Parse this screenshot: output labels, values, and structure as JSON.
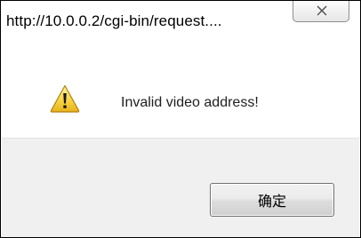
{
  "window": {
    "title": "http://10.0.0.2/cgi-bin/request....",
    "close_icon": "close-icon"
  },
  "message": {
    "icon": "warning-icon",
    "text": "Invalid video address!"
  },
  "buttons": {
    "ok_label": "确定"
  },
  "colors": {
    "footer_background": "#f0f0f0",
    "warning_yellow": "#f7d84a",
    "border": "#000000"
  }
}
